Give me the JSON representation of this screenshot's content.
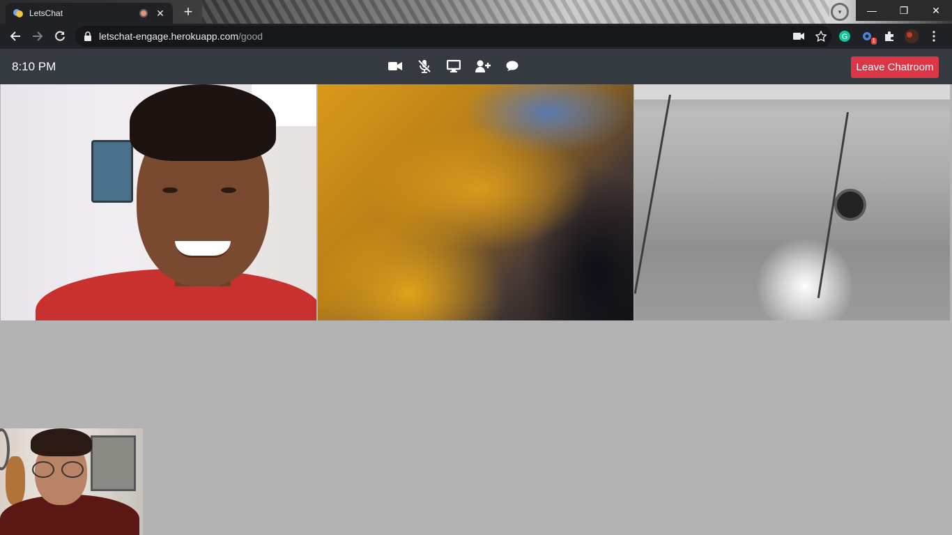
{
  "browser": {
    "tab_title": "LetsChat",
    "tab_close": "✕",
    "new_tab": "+",
    "url_host": "letschat-engage.herokuapp.com",
    "url_path": "/good",
    "extension_badge": "1",
    "window_controls": {
      "minimize": "—",
      "restore": "❐",
      "close": "✕"
    }
  },
  "app": {
    "time": "8:10 PM",
    "controls": [
      {
        "name": "video-camera",
        "icon": "video-icon"
      },
      {
        "name": "microphone-muted",
        "icon": "mic-off-icon"
      },
      {
        "name": "screen-share",
        "icon": "monitor-icon"
      },
      {
        "name": "add-participant",
        "icon": "user-plus-icon"
      },
      {
        "name": "chat",
        "icon": "chat-bubble-icon"
      }
    ],
    "leave_label": "Leave Chatroom",
    "leave_color": "#dc3545",
    "header_color": "#343a40"
  },
  "videos": [
    {
      "name": "participant-video-1"
    },
    {
      "name": "participant-video-2"
    },
    {
      "name": "participant-video-3"
    }
  ],
  "self_view": {
    "name": "local-video"
  }
}
